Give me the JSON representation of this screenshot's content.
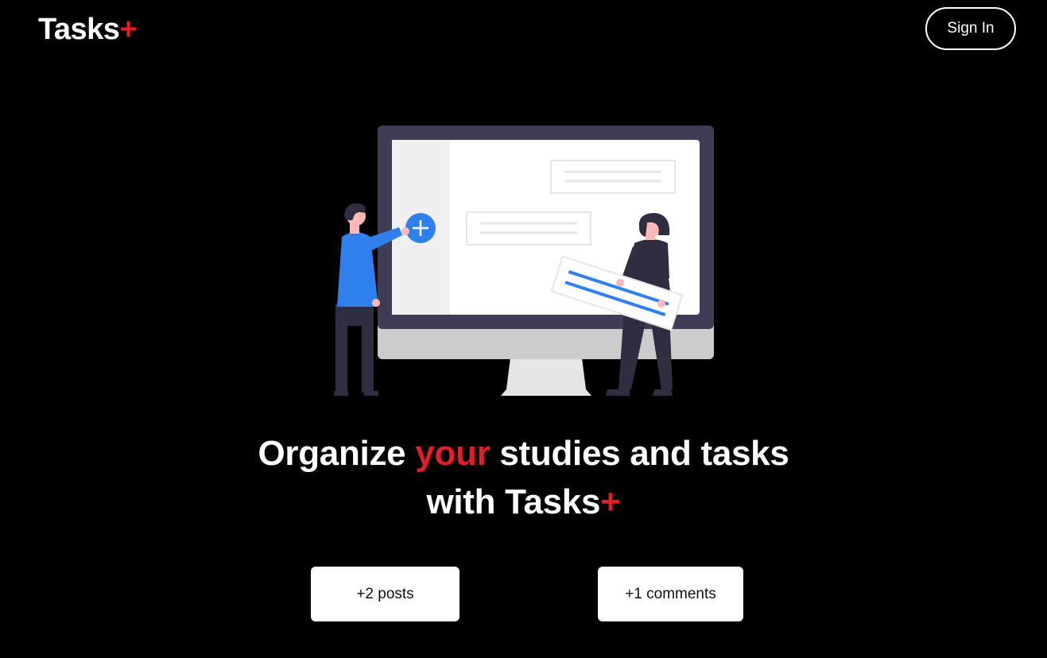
{
  "header": {
    "logo_text": "Tasks",
    "logo_plus": "+",
    "signin_label": "Sign In"
  },
  "hero": {
    "illustration": "people-managing-tasks-on-monitor-illustration"
  },
  "headline": {
    "part1": "Organize ",
    "highlight": "your",
    "part2": " studies and tasks",
    "line2_prefix": "with Tasks",
    "line2_plus": "+"
  },
  "stats": {
    "posts_label": "+2 posts",
    "comments_label": "+1 comments"
  },
  "colors": {
    "background": "#000000",
    "accent": "#e21f26",
    "text": "#ffffff",
    "monitor_frame": "#3f3d56",
    "illustration_blue": "#2f80ed"
  }
}
